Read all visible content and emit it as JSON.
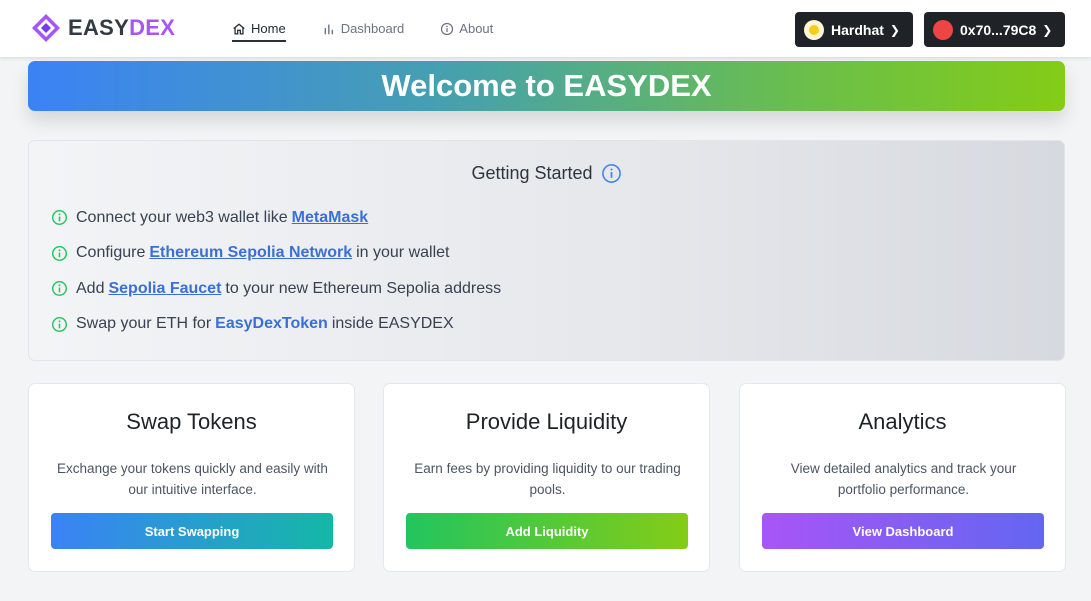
{
  "header": {
    "logo_part1": "EASY",
    "logo_part2": "DEX",
    "nav": [
      {
        "label": "Home",
        "icon": "home-icon",
        "active": true
      },
      {
        "label": "Dashboard",
        "icon": "bar-chart-icon",
        "active": false
      },
      {
        "label": "About",
        "icon": "info-icon",
        "active": false
      }
    ],
    "network_label": "Hardhat",
    "account_label": "0x70...79C8"
  },
  "banner": {
    "title": "Welcome to EASYDEX"
  },
  "getting_started": {
    "title": "Getting Started",
    "steps": [
      {
        "pre": "Connect your web3 wallet like",
        "link": "MetaMask",
        "post": ""
      },
      {
        "pre": "Configure",
        "link": "Ethereum Sepolia Network",
        "post": "in your wallet"
      },
      {
        "pre": "Add",
        "link": "Sepolia Faucet",
        "post": "to your new Ethereum Sepolia address"
      },
      {
        "pre": "Swap your ETH for",
        "link": "EasyDexToken",
        "post": "inside EASYDEX"
      }
    ]
  },
  "cards": [
    {
      "title": "Swap Tokens",
      "description": "Exchange your tokens quickly and easily with our intuitive interface.",
      "button": "Start Swapping"
    },
    {
      "title": "Provide Liquidity",
      "description": "Earn fees by providing liquidity to our trading pools.",
      "button": "Add Liquidity"
    },
    {
      "title": "Analytics",
      "description": "View detailed analytics and track your portfolio performance.",
      "button": "View Dashboard"
    }
  ],
  "colors": {
    "brand_purple": "#a855f7",
    "link_blue": "#3b6fd6",
    "info_green": "#22c55e",
    "dark_button": "#1f2328"
  }
}
